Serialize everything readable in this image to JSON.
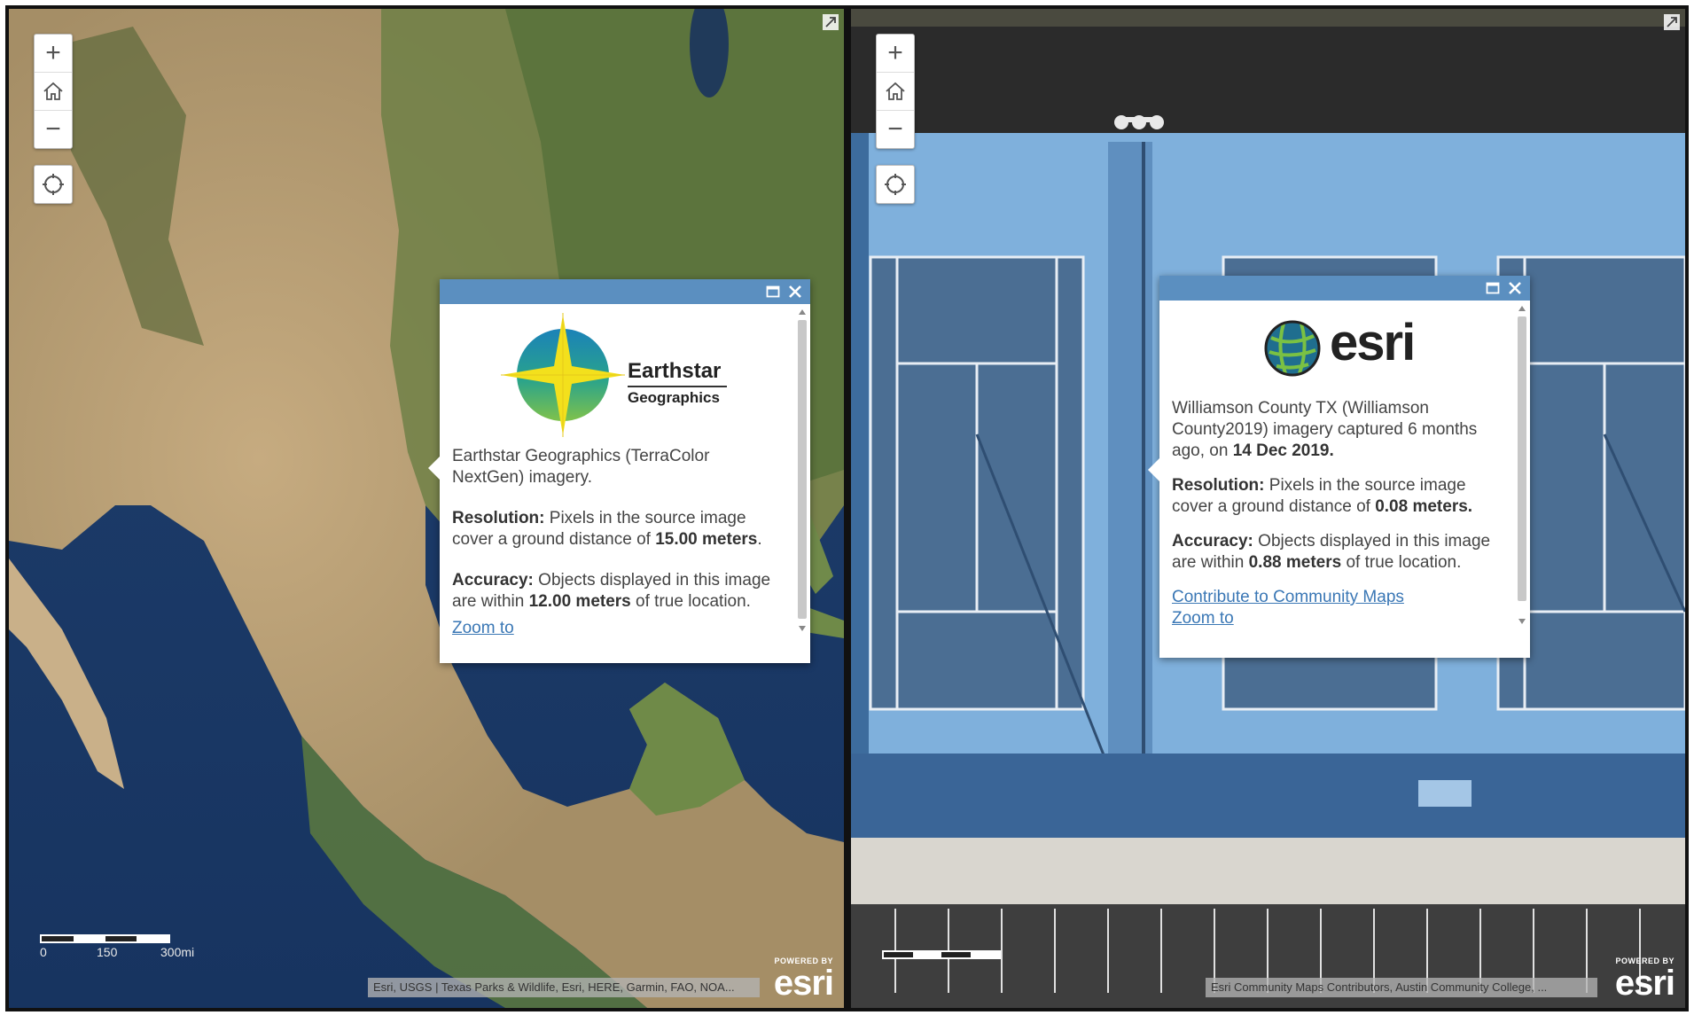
{
  "left_map": {
    "controls": {
      "zoom_in": "+",
      "zoom_out": "−"
    },
    "popup": {
      "logo_line1": "Earthstar",
      "logo_line2": "Geographics",
      "description": "Earthstar Geographics (TerraColor NextGen) imagery.",
      "resolution_label": "Resolution:",
      "resolution_text": "Pixels in the source image cover a ground distance of",
      "resolution_value": "15.00 meters",
      "accuracy_label": "Accuracy:",
      "accuracy_text": "Objects displayed in this image are within",
      "accuracy_value": "12.00 meters",
      "accuracy_suffix": "of true location.",
      "zoom_link": "Zoom to"
    },
    "scale": {
      "label_0": "0",
      "label_1": "150",
      "label_2": "300mi"
    },
    "attribution": "Esri, USGS | Texas Parks & Wildlife, Esri, HERE, Garmin, FAO, NOA...",
    "powered_by": "POWERED BY",
    "brand": "esri"
  },
  "right_map": {
    "controls": {
      "zoom_in": "+",
      "zoom_out": "−"
    },
    "popup": {
      "logo_text": "esri",
      "description_a": "Williamson County TX (Williamson County2019) imagery captured 6 months ago, on",
      "description_date": "14 Dec 2019.",
      "resolution_label": "Resolution:",
      "resolution_text": "Pixels in the source image cover a ground distance of",
      "resolution_value": "0.08 meters.",
      "accuracy_label": "Accuracy:",
      "accuracy_text": "Objects displayed in this image are within",
      "accuracy_value": "0.88 meters",
      "accuracy_suffix": "of true location.",
      "contribute_link": "Contribute to Community Maps",
      "zoom_link": "Zoom to"
    },
    "attribution": "Esri Community Maps Contributors, Austin Community College, ...",
    "powered_by": "POWERED BY",
    "brand": "esri"
  },
  "colors": {
    "popup_header": "#5b8fc0",
    "link": "#3a77b5",
    "court_blue": "#7fb0dc"
  }
}
